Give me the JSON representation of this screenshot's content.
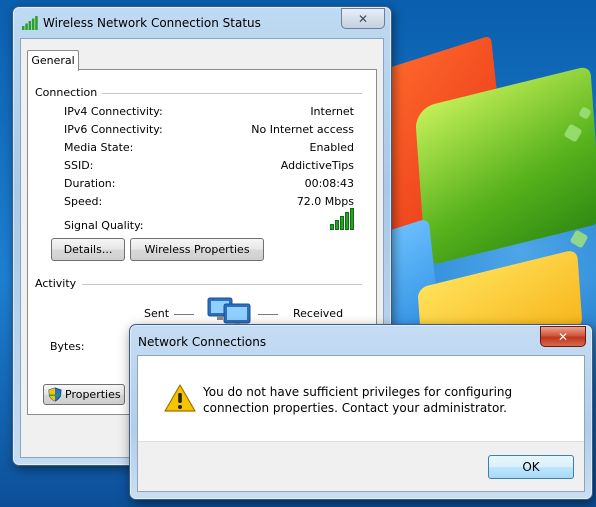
{
  "status_window": {
    "title": "Wireless Network Connection Status",
    "close_glyph": "✕",
    "tab": "General",
    "connection": {
      "label": "Connection",
      "rows": [
        {
          "label": "IPv4 Connectivity:",
          "value": "Internet"
        },
        {
          "label": "IPv6 Connectivity:",
          "value": "No Internet access"
        },
        {
          "label": "Media State:",
          "value": "Enabled"
        },
        {
          "label": "SSID:",
          "value": "AddictiveTips"
        },
        {
          "label": "Duration:",
          "value": "00:08:43"
        },
        {
          "label": "Speed:",
          "value": "72.0 Mbps"
        }
      ],
      "signal_label": "Signal Quality:",
      "signal_bars": 5,
      "details_button": "Details...",
      "wireless_properties_button": "Wireless Properties"
    },
    "activity": {
      "label": "Activity",
      "sent": "Sent",
      "received": "Received",
      "bytes_label": "Bytes:",
      "properties_button": "Properties"
    }
  },
  "dialog": {
    "title": "Network Connections",
    "close_glyph": "✕",
    "message": "You do not have sufficient privileges for configuring connection properties. Contact your administrator.",
    "ok_button": "OK"
  },
  "colors": {
    "signal_green": "#2aa02a",
    "warning_yellow": "#f5c400",
    "close_red": "#c0361d"
  }
}
